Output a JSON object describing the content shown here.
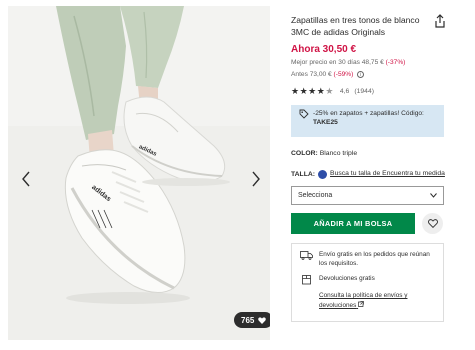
{
  "gallery": {
    "prev_icon": "chevron-left-icon",
    "next_icon": "chevron-right-icon",
    "likes_count": "765",
    "likes_icon": "heart-icon",
    "brand_mark_left": "adidas",
    "brand_mark_right": "adidas"
  },
  "product": {
    "title": "Zapatillas en tres tonos de blanco 3MC de adidas Originals",
    "share_icon": "share-icon",
    "price_now": "Ahora 30,50 €",
    "best_price_label": "Mejor precio en 30 días 48,75 €",
    "best_price_discount": "(-37%)",
    "before_label": "Antes 73,00 €",
    "before_discount": "(-59%)",
    "info_icon": "info-icon",
    "rating_score": "4,6",
    "rating_count": "(1944)",
    "rating_value": 4.5,
    "rating_max": 5
  },
  "promo": {
    "icon": "tag-icon",
    "text": "-25% en zapatos + zapatillas! Código:",
    "code": "TAKE25",
    "bg_color": "#d7e7f3"
  },
  "color": {
    "label": "COLOR:",
    "value": "Blanco triple"
  },
  "size": {
    "label": "TALLA:",
    "fit_link": "Busca tu talla de Encuentra tu medida",
    "select_value": "Selecciona"
  },
  "actions": {
    "add_to_bag": "AÑADIR A MI BOLSA",
    "add_color": "#018849",
    "save_icon": "heart-outline-icon"
  },
  "delivery": {
    "shipping_text": "Envío gratis en los pedidos que reúnan los requisitos.",
    "shipping_icon": "truck-icon",
    "returns_text": "Devoluciones gratis",
    "returns_icon": "return-box-icon",
    "policy_link": "Consulta la política de envíos y devoluciones",
    "external_icon": "external-link-icon"
  },
  "colors": {
    "sale_red": "#d01345",
    "text": "#2d2d2d"
  }
}
